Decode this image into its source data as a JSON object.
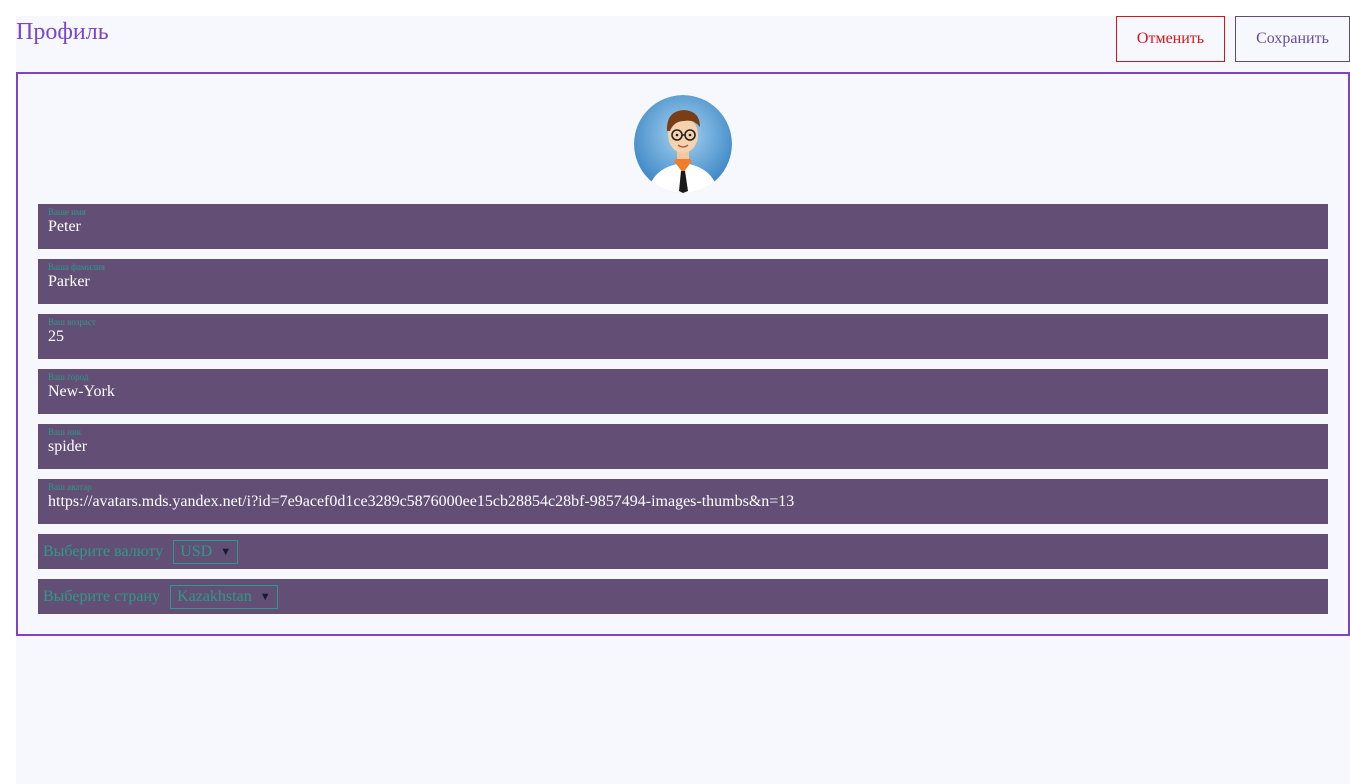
{
  "header": {
    "title": "Профиль",
    "cancel_label": "Отменить",
    "save_label": "Сохранить"
  },
  "fields": [
    {
      "label": "Ваше имя",
      "value": "Peter"
    },
    {
      "label": "Ваша фамилия",
      "value": "Parker"
    },
    {
      "label": "Ваш возраст",
      "value": "25"
    },
    {
      "label": "Ваш город",
      "value": "New-York"
    },
    {
      "label": "Ваш ник",
      "value": "spider"
    },
    {
      "label": "Ваш аватар",
      "value": "https://avatars.mds.yandex.net/i?id=7e9acef0d1ce3289c5876000ee15cb28854c28bf-9857494-images-thumbs&n=13"
    }
  ],
  "currency": {
    "label": "Выберите валюту",
    "selected": "USD"
  },
  "country": {
    "label": "Выберите страну",
    "selected": "Kazakhstan"
  },
  "colors": {
    "accent": "#8241c7",
    "field_bg": "#634f76",
    "label_teal": "#2c9a86",
    "cancel_red": "#d8141b"
  }
}
